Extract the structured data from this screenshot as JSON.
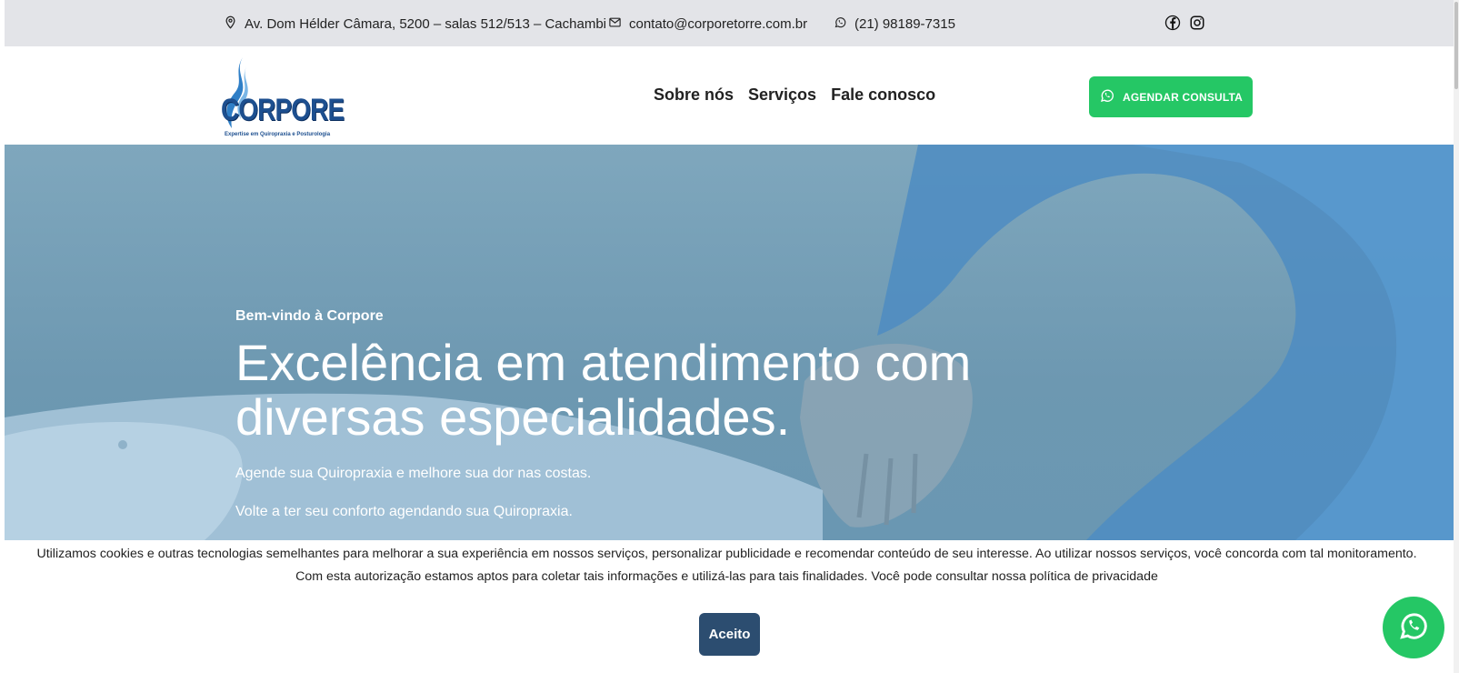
{
  "topbar": {
    "address": "Av. Dom Hélder Câmara, 5200 – salas 512/513 – Cachambi",
    "email": "contato@corporetorre.com.br",
    "phone": "(21) 98189-7315",
    "icons": [
      "location-pin-icon",
      "mail-icon",
      "whatsapp-icon",
      "facebook-icon",
      "instagram-icon"
    ]
  },
  "header": {
    "logo_text": "CORPORE",
    "logo_tagline": "Expertise em Quiropraxia e Posturologia",
    "nav": [
      "Sobre nós",
      "Serviços",
      "Fale conosco"
    ],
    "cta_label": "AGENDAR CONSULTA"
  },
  "hero": {
    "kicker": "Bem-vindo à Corpore",
    "title_line1": "Excelência em atendimento com",
    "title_line2": "diversas especialidades.",
    "sub1": "Agende sua Quiropraxia e melhore sua dor nas costas.",
    "sub2": "Volte a ter seu conforto agendando sua Quiropraxia."
  },
  "cookie": {
    "text_line1": "Utilizamos cookies e outras tecnologias semelhantes para melhorar a sua experiência em nossos serviços, personalizar publicidade e recomendar conteúdo de seu interesse. Ao utilizar nossos serviços, você concorda com tal monitoramento.",
    "text_line2": "Com esta autorização estamos aptos para coletar tais informações e utilizá-las para tais finalidades. Você pode consultar nossa política de privacidade",
    "accept_label": "Aceito"
  },
  "colors": {
    "whatsapp_green": "#25c765",
    "accept_blue": "#2c4d70",
    "topbar_gray": "#e3e4e8",
    "hero_blue": "#6d98b1",
    "logo_blue": "#1d4f8f"
  }
}
